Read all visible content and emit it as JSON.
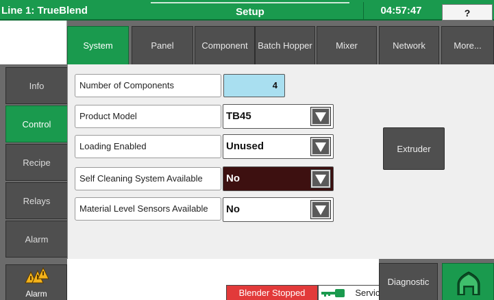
{
  "titlebar": {
    "line_name": "Line 1: TrueBlend",
    "screen_title": "Setup",
    "clock": "04:57:47",
    "help_label": "?"
  },
  "tabs": [
    {
      "label": "System",
      "active": true
    },
    {
      "label": "Panel",
      "active": false
    },
    {
      "label": "Component",
      "active": false
    },
    {
      "label": "Batch Hopper",
      "active": false
    },
    {
      "label": "Mixer",
      "active": false
    },
    {
      "label": "Network",
      "active": false
    },
    {
      "label": "More...",
      "active": false
    }
  ],
  "sidebar": {
    "items": [
      {
        "label": "Info",
        "active": false
      },
      {
        "label": "Control",
        "active": true
      },
      {
        "label": "Recipe",
        "active": false
      },
      {
        "label": "Relays",
        "active": false
      },
      {
        "label": "Alarm",
        "active": false
      }
    ]
  },
  "settings": {
    "num_components": {
      "label": "Number of Components",
      "value": "4"
    },
    "product_model": {
      "label": "Product Model",
      "value": "TB45"
    },
    "loading_enabled": {
      "label": "Loading Enabled",
      "value": "Unused"
    },
    "self_cleaning": {
      "label": "Self Cleaning System Available",
      "value": "No"
    },
    "level_sensors": {
      "label": "Material Level Sensors Available",
      "value": "No"
    }
  },
  "extruder_label": "Extruder",
  "bottom": {
    "alarm_label": "Alarm",
    "blender_status": "Blender Stopped",
    "service_label": "Service",
    "diagnostic_label": "Diagnostic"
  },
  "colors": {
    "brand_green": "#1a9a4e",
    "button_gray": "#4f4f4f",
    "value_highlight": "#a9dff0",
    "warning_dark_red": "#3d1010",
    "status_red": "#e23a3a",
    "alarm_yellow": "#f3b21a"
  },
  "icons": [
    "warning-triangles-icon",
    "key-icon",
    "home-icon",
    "dropdown-arrow-icon"
  ]
}
